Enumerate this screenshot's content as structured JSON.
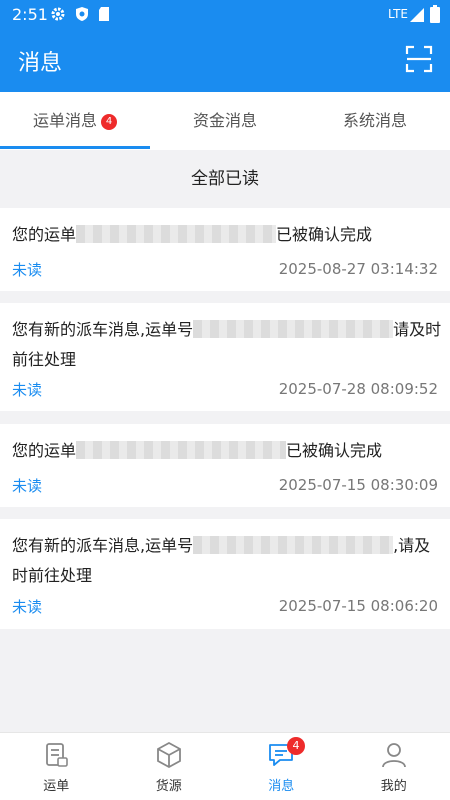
{
  "status_bar": {
    "time": "2:51",
    "network": "LTE"
  },
  "app_bar": {
    "title": "消息"
  },
  "tabs": [
    {
      "label": "运单消息",
      "badge": "4",
      "active": true
    },
    {
      "label": "资金消息",
      "active": false
    },
    {
      "label": "系统消息",
      "active": false
    }
  ],
  "mark_all_read": "全部已读",
  "messages": [
    {
      "text_before": "您的运单",
      "text_after": "已被确认完成",
      "status": "未读",
      "time": "2025-08-27 03:14:32"
    },
    {
      "text_before": "您有新的派车消息,运单号",
      "text_after": "请及时前往处理",
      "status": "未读",
      "time": "2025-07-28 08:09:52"
    },
    {
      "text_before": "您的运单",
      "text_after": "已被确认完成",
      "status": "未读",
      "time": "2025-07-15 08:30:09"
    },
    {
      "text_before": "您有新的派车消息,运单号",
      "text_after": ",请及时前往处理",
      "status": "未读",
      "time": "2025-07-15 08:06:20"
    }
  ],
  "bottom_nav": [
    {
      "label": "运单",
      "icon": "waybill-icon",
      "active": false
    },
    {
      "label": "货源",
      "icon": "box-icon",
      "active": false
    },
    {
      "label": "消息",
      "icon": "message-icon",
      "active": true,
      "badge": "4"
    },
    {
      "label": "我的",
      "icon": "user-icon",
      "active": false
    }
  ],
  "colors": {
    "primary": "#1a8cf0",
    "badge": "#ee2b2b",
    "background": "#f2f2f4"
  }
}
